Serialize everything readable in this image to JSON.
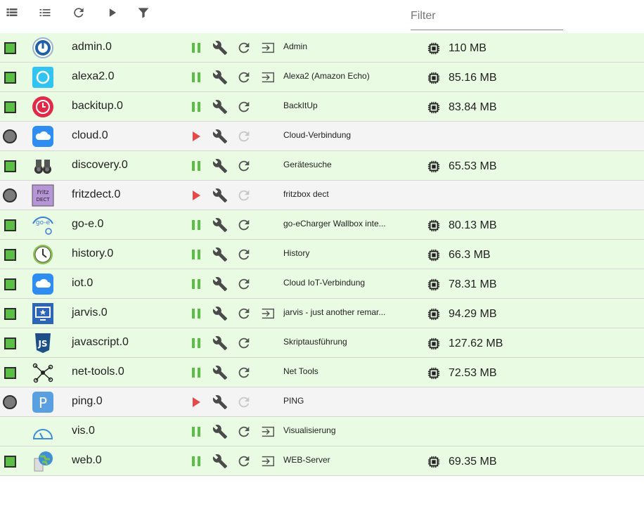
{
  "toolbar": {
    "filter_placeholder": "Filter",
    "icons": [
      "view-list-icon",
      "list-icon",
      "refresh-icon",
      "play-icon",
      "filter-icon"
    ]
  },
  "colors": {
    "running_bg": "#e9fbe3",
    "stopped_bg": "#f4f4f4",
    "pause": "#5cbf45",
    "play": "#e34a4a",
    "wrench": "#4a4a4a"
  },
  "instances": [
    {
      "name": "admin.0",
      "title": "Admin",
      "state": "running",
      "memory": "110 MB",
      "link": true,
      "icon": "admin"
    },
    {
      "name": "alexa2.0",
      "title": "Alexa2 (Amazon Echo)",
      "state": "running",
      "memory": "85.16 MB",
      "link": true,
      "icon": "alexa"
    },
    {
      "name": "backitup.0",
      "title": "BackItUp",
      "state": "running",
      "memory": "83.84 MB",
      "link": false,
      "icon": "backitup"
    },
    {
      "name": "cloud.0",
      "title": "Cloud-Verbindung",
      "state": "stopped",
      "memory": "",
      "link": false,
      "icon": "cloud"
    },
    {
      "name": "discovery.0",
      "title": "Gerätesuche",
      "state": "running",
      "memory": "65.53 MB",
      "link": false,
      "icon": "discovery"
    },
    {
      "name": "fritzdect.0",
      "title": "fritzbox dect",
      "state": "stopped",
      "memory": "",
      "link": false,
      "icon": "fritz"
    },
    {
      "name": "go-e.0",
      "title": "go-eCharger Wallbox inte...",
      "state": "running",
      "memory": "80.13 MB",
      "link": false,
      "icon": "goe"
    },
    {
      "name": "history.0",
      "title": "History",
      "state": "running",
      "memory": "66.3 MB",
      "link": false,
      "icon": "history"
    },
    {
      "name": "iot.0",
      "title": "Cloud IoT-Verbindung",
      "state": "running",
      "memory": "78.31 MB",
      "link": false,
      "icon": "cloud"
    },
    {
      "name": "jarvis.0",
      "title": "jarvis - just another remar...",
      "state": "running",
      "memory": "94.29 MB",
      "link": true,
      "icon": "jarvis"
    },
    {
      "name": "javascript.0",
      "title": "Skriptausführung",
      "state": "running",
      "memory": "127.62 MB",
      "link": false,
      "icon": "js"
    },
    {
      "name": "net-tools.0",
      "title": "Net Tools",
      "state": "running",
      "memory": "72.53 MB",
      "link": false,
      "icon": "nettools"
    },
    {
      "name": "ping.0",
      "title": "PING",
      "state": "stopped",
      "memory": "",
      "link": false,
      "icon": "ping"
    },
    {
      "name": "vis.0",
      "title": "Visualisierung",
      "state": "plain",
      "memory": "",
      "link": true,
      "icon": "vis"
    },
    {
      "name": "web.0",
      "title": "WEB-Server",
      "state": "running",
      "memory": "69.35 MB",
      "link": true,
      "icon": "web"
    }
  ]
}
